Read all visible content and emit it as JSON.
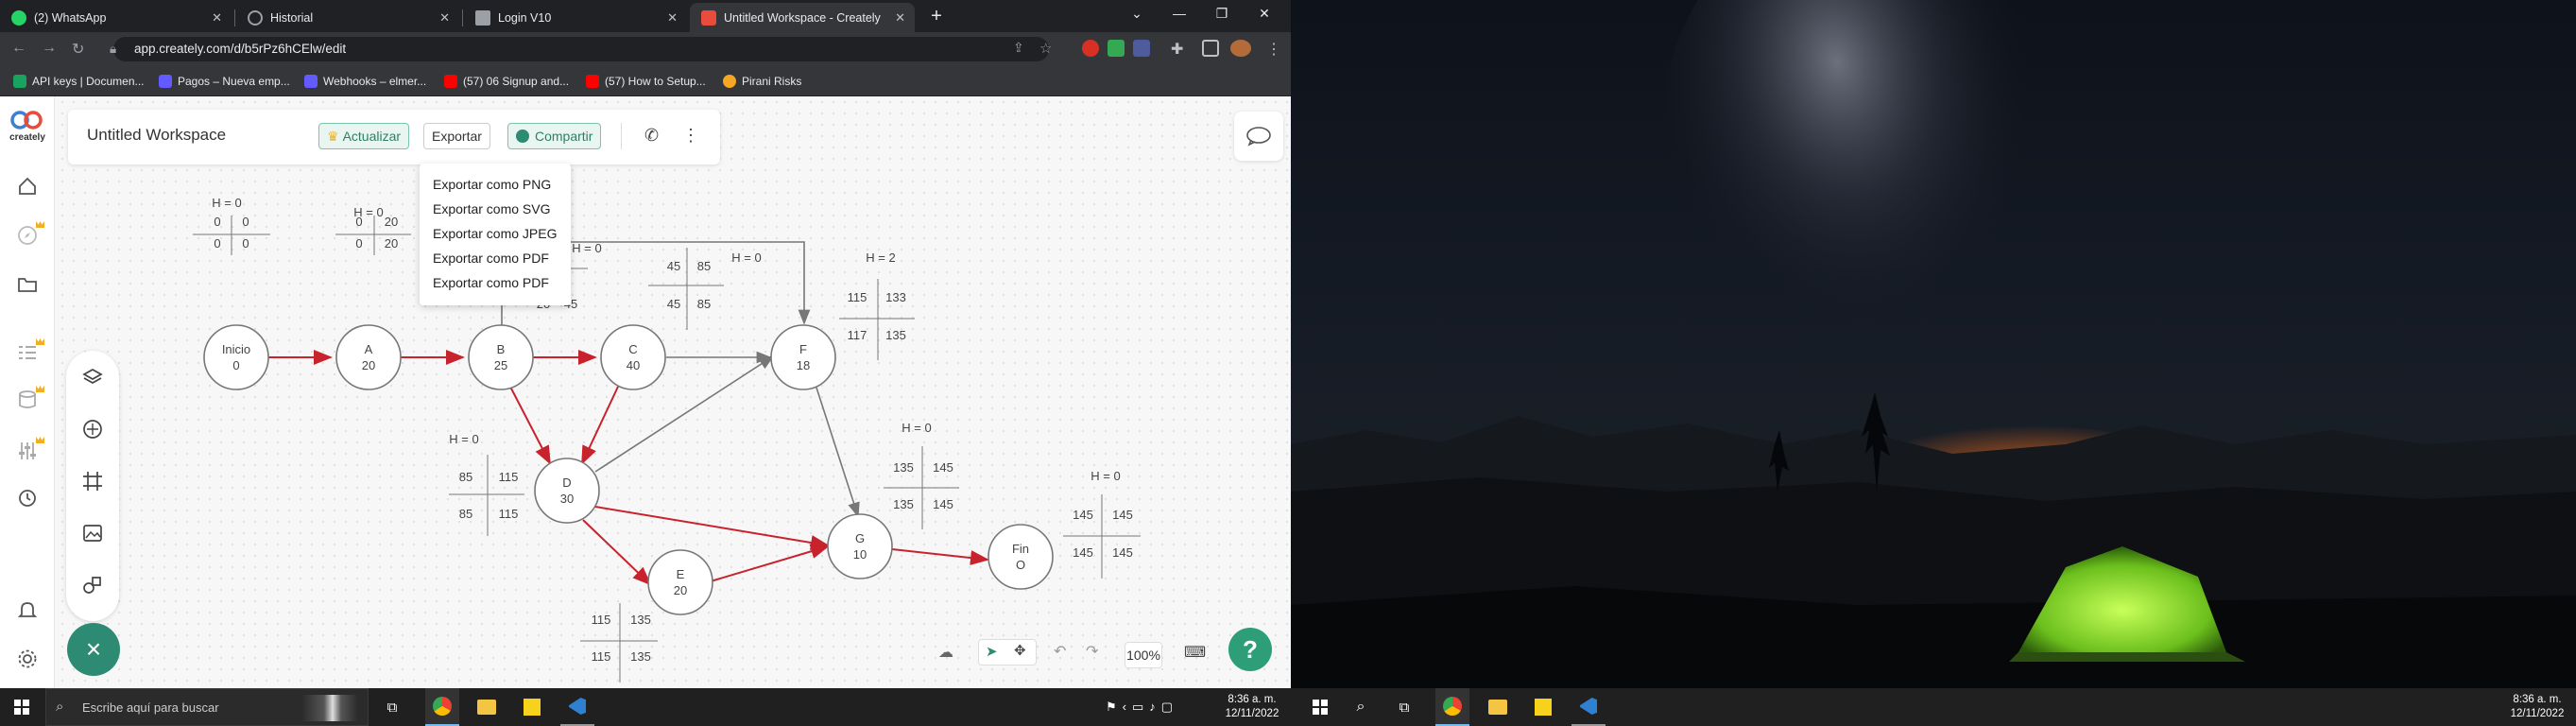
{
  "browser": {
    "tabs": [
      {
        "title": "(2) WhatsApp",
        "icon": "whatsapp-icon",
        "color": "#25d366"
      },
      {
        "title": "Historial",
        "icon": "history-icon",
        "color": "#9aa0a6"
      },
      {
        "title": "Login V10",
        "icon": "home-icon",
        "color": "#9aa0a6"
      },
      {
        "title": "Untitled Workspace - Creately",
        "icon": "creately-icon",
        "color": "#e94b3c"
      }
    ],
    "url": "app.creately.com/d/b5rPz6hCElw/edit",
    "bookmarks": [
      {
        "label": "API keys | Documen...",
        "color": "#1aa260"
      },
      {
        "label": "Pagos – Nueva emp...",
        "color": "#635bff"
      },
      {
        "label": "Webhooks – elmer...",
        "color": "#635bff"
      },
      {
        "label": "(57) 06 Signup and...",
        "color": "#ff0000"
      },
      {
        "label": "(57) How to Setup...",
        "color": "#ff0000"
      },
      {
        "label": "Pirani Risks",
        "color": "#f5a623"
      }
    ]
  },
  "app": {
    "logo_text": "creately",
    "workspace_title": "Untitled Workspace",
    "upgrade_label": "Actualizar",
    "export_label": "Exportar",
    "share_label": "Compartir",
    "export_menu": [
      "Exportar como PNG",
      "Exportar como SVG",
      "Exportar como JPEG",
      "Exportar como PDF",
      "Exportar como PDF"
    ],
    "zoom": "100%",
    "fab_symbol": "×",
    "help_symbol": "?",
    "accent": "#2e8b73"
  },
  "diagram": {
    "nodes": [
      {
        "name": "Inicio",
        "value": "0"
      },
      {
        "name": "A",
        "value": "20"
      },
      {
        "name": "B",
        "value": "25"
      },
      {
        "name": "C",
        "value": "40"
      },
      {
        "name": "D",
        "value": "30"
      },
      {
        "name": "E",
        "value": "20"
      },
      {
        "name": "F",
        "value": "18"
      },
      {
        "name": "G",
        "value": "10"
      },
      {
        "name": "Fin",
        "value": "O"
      }
    ],
    "tables": [
      {
        "h": "H = 0",
        "cells": [
          "0",
          "0",
          "0",
          "0"
        ]
      },
      {
        "h": "H = 0",
        "cells": [
          "0",
          "20",
          "0",
          "20"
        ]
      },
      {
        "h": "H = 0",
        "cells": [
          "",
          "",
          "20",
          "45"
        ]
      },
      {
        "h": "",
        "cells": [
          "45",
          "85",
          "45",
          "85"
        ]
      },
      {
        "h": "H = 0",
        "cells": [
          "",
          "",
          "",
          ""
        ]
      },
      {
        "h": "H = 2",
        "cells": [
          "115",
          "133",
          "117",
          "135"
        ]
      },
      {
        "h": "H = 0",
        "cells": [
          "85",
          "115",
          "85",
          "115"
        ]
      },
      {
        "h": "H = 0",
        "cells": [
          "135",
          "145",
          "135",
          "145"
        ]
      },
      {
        "h": "H = 0",
        "cells": [
          "145",
          "145",
          "145",
          "145"
        ]
      },
      {
        "h": "",
        "cells": [
          "115",
          "135",
          "115",
          "135"
        ]
      }
    ],
    "critical_color": "#c8232c",
    "normal_color": "#777777"
  },
  "taskbar": {
    "search_placeholder": "Escribe aquí para buscar",
    "time": "8:36 a. m.",
    "date": "12/11/2022"
  }
}
